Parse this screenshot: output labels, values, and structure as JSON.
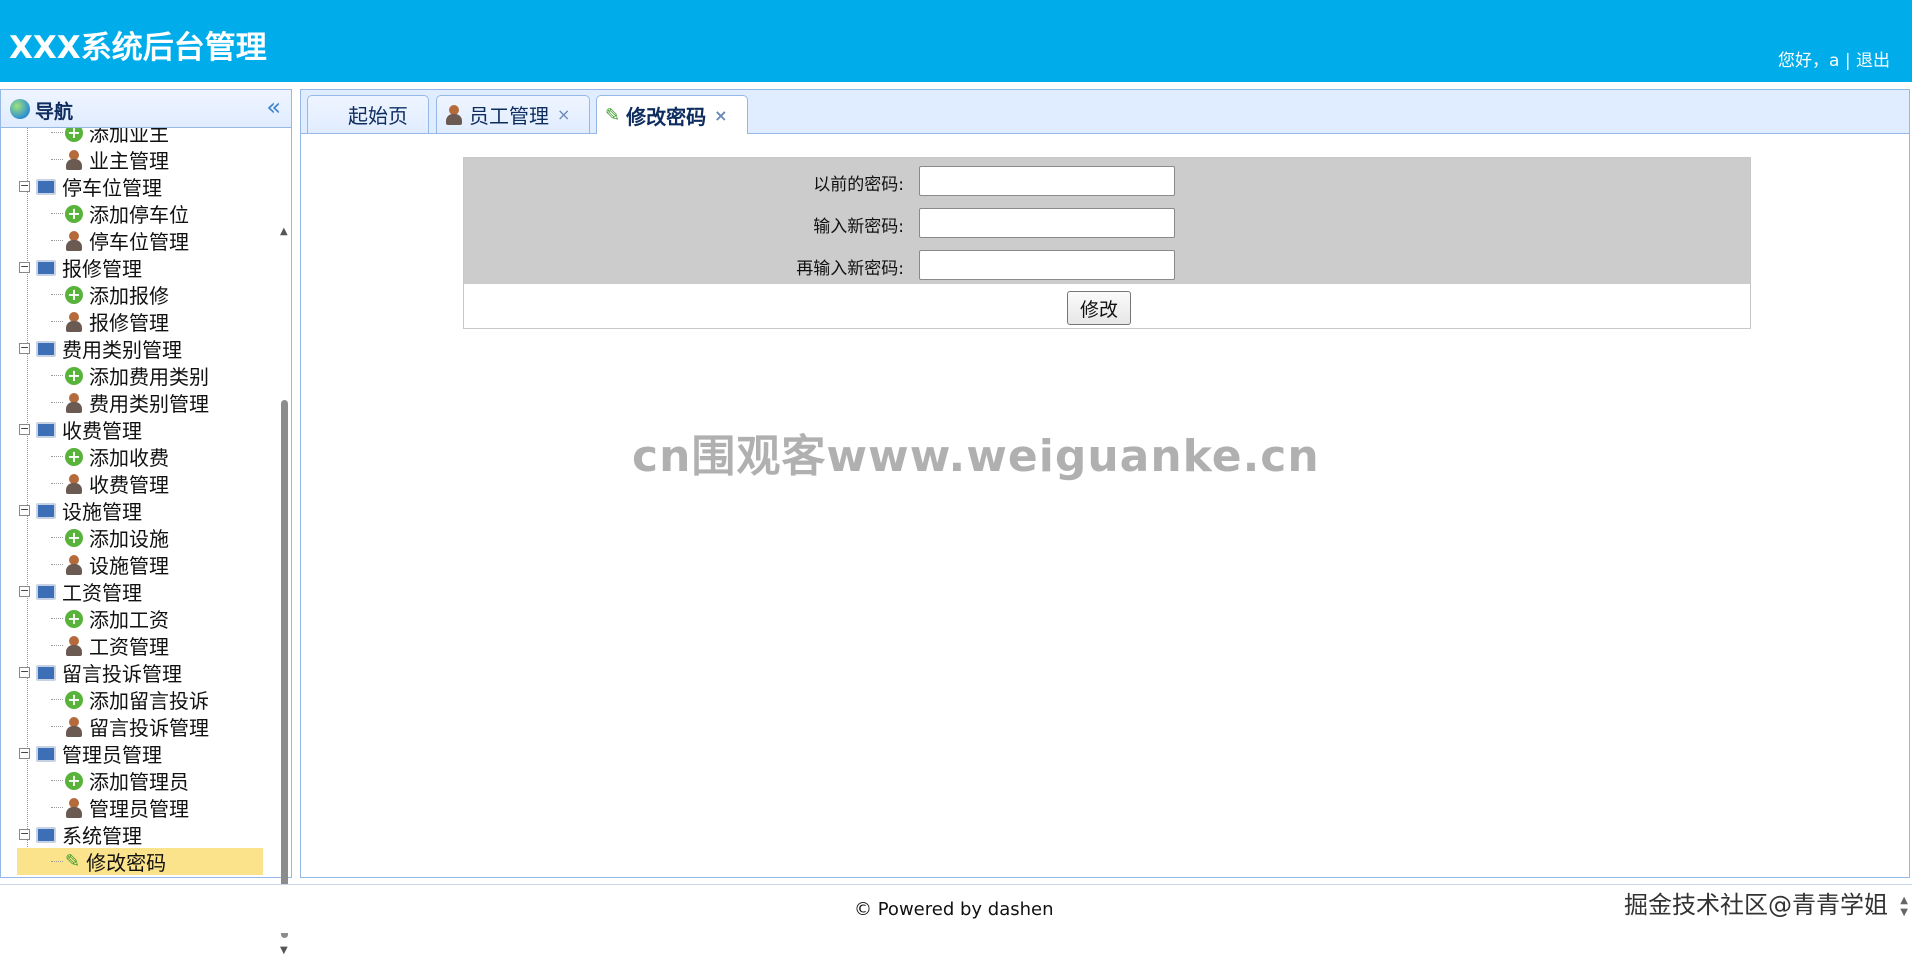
{
  "header": {
    "title": "XXX系统后台管理",
    "greeting": "您好，a | ",
    "logout": "退出"
  },
  "sidebar": {
    "title": "导航",
    "collapse_icon": "«",
    "tree": [
      {
        "label": "添加业主",
        "kind": "add",
        "level": "child"
      },
      {
        "label": "业主管理",
        "kind": "user",
        "level": "child"
      },
      {
        "label": "停车位管理",
        "kind": "group",
        "level": "parent"
      },
      {
        "label": "添加停车位",
        "kind": "add",
        "level": "child"
      },
      {
        "label": "停车位管理",
        "kind": "user",
        "level": "child"
      },
      {
        "label": "报修管理",
        "kind": "group",
        "level": "parent"
      },
      {
        "label": "添加报修",
        "kind": "add",
        "level": "child"
      },
      {
        "label": "报修管理",
        "kind": "user",
        "level": "child"
      },
      {
        "label": "费用类别管理",
        "kind": "group",
        "level": "parent"
      },
      {
        "label": "添加费用类别",
        "kind": "add",
        "level": "child"
      },
      {
        "label": "费用类别管理",
        "kind": "user",
        "level": "child"
      },
      {
        "label": "收费管理",
        "kind": "group",
        "level": "parent"
      },
      {
        "label": "添加收费",
        "kind": "add",
        "level": "child"
      },
      {
        "label": "收费管理",
        "kind": "user",
        "level": "child"
      },
      {
        "label": "设施管理",
        "kind": "group",
        "level": "parent"
      },
      {
        "label": "添加设施",
        "kind": "add",
        "level": "child"
      },
      {
        "label": "设施管理",
        "kind": "user",
        "level": "child"
      },
      {
        "label": "工资管理",
        "kind": "group",
        "level": "parent"
      },
      {
        "label": "添加工资",
        "kind": "add",
        "level": "child"
      },
      {
        "label": "工资管理",
        "kind": "user",
        "level": "child"
      },
      {
        "label": "留言投诉管理",
        "kind": "group",
        "level": "parent"
      },
      {
        "label": "添加留言投诉",
        "kind": "add",
        "level": "child"
      },
      {
        "label": "留言投诉管理",
        "kind": "user",
        "level": "child"
      },
      {
        "label": "管理员管理",
        "kind": "group",
        "level": "parent"
      },
      {
        "label": "添加管理员",
        "kind": "add",
        "level": "child"
      },
      {
        "label": "管理员管理",
        "kind": "user",
        "level": "child"
      },
      {
        "label": "系统管理",
        "kind": "group",
        "level": "parent"
      },
      {
        "label": "修改密码",
        "kind": "pencil",
        "level": "child",
        "selected": true
      }
    ]
  },
  "tabs": [
    {
      "label": "起始页",
      "icon": "none",
      "closable": false,
      "active": false
    },
    {
      "label": "员工管理",
      "icon": "user-icon",
      "closable": true,
      "active": false
    },
    {
      "label": "修改密码",
      "icon": "pencil-icon",
      "closable": true,
      "active": true
    }
  ],
  "form": {
    "old_password_label": "以前的密码:",
    "new_password_label": "输入新密码:",
    "confirm_password_label": "再输入新密码:",
    "submit_label": "修改"
  },
  "watermark": "cn围观客www.weiguanke.cn",
  "footer": {
    "powered": "© Powered by dashen",
    "credit": "掘金技术社区@青青学姐"
  },
  "colors": {
    "header_bg": "#00adea",
    "panel_border": "#95b8e7",
    "tab_bar_bg": "#e0ecff",
    "form_gray": "#cccccc",
    "selected_bg": "#fbe38c"
  }
}
